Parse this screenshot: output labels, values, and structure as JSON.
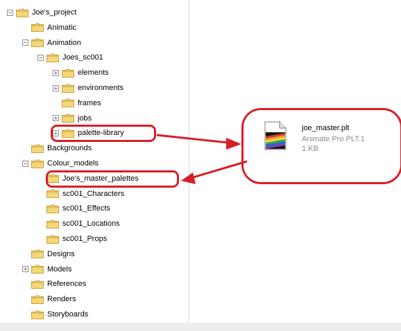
{
  "tree": [
    {
      "label": "Joe's_project",
      "depth": 0,
      "expander": "minus"
    },
    {
      "label": "Animatic",
      "depth": 1,
      "expander": "none"
    },
    {
      "label": "Animation",
      "depth": 1,
      "expander": "minus"
    },
    {
      "label": "Joes_sc001",
      "depth": 2,
      "expander": "minus"
    },
    {
      "label": "elements",
      "depth": 3,
      "expander": "plus"
    },
    {
      "label": "environments",
      "depth": 3,
      "expander": "plus"
    },
    {
      "label": "frames",
      "depth": 3,
      "expander": "none"
    },
    {
      "label": "jobs",
      "depth": 3,
      "expander": "plus"
    },
    {
      "label": "palette-library",
      "depth": 3,
      "expander": "plus"
    },
    {
      "label": "Backgrounds",
      "depth": 1,
      "expander": "none"
    },
    {
      "label": "Colour_models",
      "depth": 1,
      "expander": "minus"
    },
    {
      "label": "Joe's_master_palettes",
      "depth": 2,
      "expander": "none"
    },
    {
      "label": "sc001_Characters",
      "depth": 2,
      "expander": "none"
    },
    {
      "label": "sc001_Effects",
      "depth": 2,
      "expander": "none"
    },
    {
      "label": "sc001_Locations",
      "depth": 2,
      "expander": "none"
    },
    {
      "label": "sc001_Props",
      "depth": 2,
      "expander": "none"
    },
    {
      "label": "Designs",
      "depth": 1,
      "expander": "none"
    },
    {
      "label": "Models",
      "depth": 1,
      "expander": "plus"
    },
    {
      "label": "References",
      "depth": 1,
      "expander": "none"
    },
    {
      "label": "Renders",
      "depth": 1,
      "expander": "none"
    },
    {
      "label": "Storyboards",
      "depth": 1,
      "expander": "none"
    }
  ],
  "file": {
    "name": "joe_master.plt",
    "type": "Animate Pro PLT.1",
    "size": "1 KB"
  },
  "colors": {
    "highlight": "#d81e25",
    "folder": "#f3d77a",
    "folder_edge": "#c9a23c"
  }
}
